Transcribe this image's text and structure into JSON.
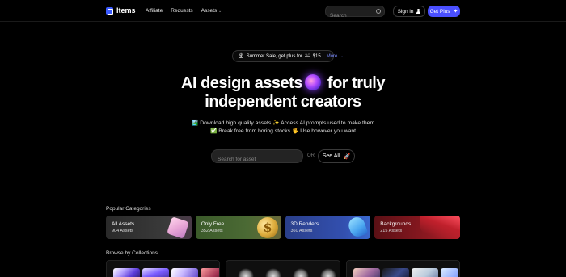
{
  "header": {
    "logo_text": "Items",
    "nav": [
      "Affiliate",
      "Requests",
      "Assets"
    ],
    "search_placeholder": "Search",
    "sign_in": "Sign in",
    "get_plus": "Get Plus"
  },
  "promo": {
    "emoji": "🏝",
    "text": "Summer Sale, get plus for",
    "old_price": "30",
    "new_price": "$15",
    "more": "More"
  },
  "hero": {
    "line1_a": "AI design assets",
    "line1_b": "for truly",
    "line2": "independent creators",
    "sub1": "🏞️ Download high quality assets ✨ Access AI prompts used to make them",
    "sub2": "✅ Break free from boring stocks 🖐 Use however you want",
    "search_placeholder": "Search for asset",
    "or": "OR",
    "see_all": "See All"
  },
  "categories": {
    "title": "Popular Categories",
    "items": [
      {
        "name": "All Assets",
        "count": "904 Assets"
      },
      {
        "name": "Only Free",
        "count": "352 Assets"
      },
      {
        "name": "3D Renders",
        "count": "360 Assets"
      },
      {
        "name": "Backgrounds",
        "count": "215 Assets"
      }
    ]
  },
  "collections": {
    "title": "Browse by Collections"
  },
  "colors": {
    "accent": "#4a4fff",
    "promo_link": "#7a8bff"
  }
}
